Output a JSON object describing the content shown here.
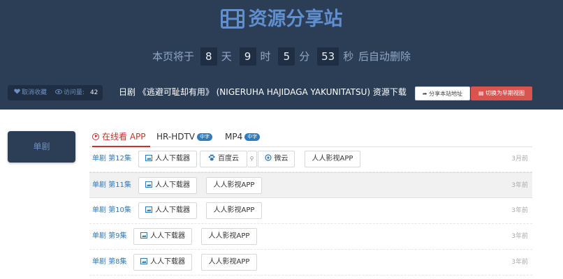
{
  "header": {
    "title": "资源分享站",
    "countdown": {
      "prefix": "本页将于",
      "days": "8",
      "days_unit": "天",
      "hours": "9",
      "hours_unit": "时",
      "minutes": "5",
      "minutes_unit": "分",
      "seconds": "53",
      "seconds_unit": "秒",
      "suffix": "后自动删除"
    },
    "stats": {
      "unfavorite": "取消收藏",
      "visits_label": "访问量:",
      "visits": "42"
    },
    "marquee": "日剧 《逃避可耻却有用》 (NIGERUHA HAJIDAGA YAKUNITATSU) 资源下载",
    "share_button": "分享本站地址",
    "switch_button": "切换为早期视图"
  },
  "sidebar": {
    "category_label": "单剧"
  },
  "tabs": [
    {
      "label": "在线看 APP",
      "badge": ""
    },
    {
      "label": "HR-HDTV",
      "badge": "中字"
    },
    {
      "label": "MP4",
      "badge": "中字"
    }
  ],
  "episodes": [
    {
      "label": "单剧 第12集",
      "time": "3月前",
      "buttons": [
        "人人下载器",
        "百度云",
        "微云",
        "人人影视APP"
      ]
    },
    {
      "label": "单剧 第11集",
      "time": "3年前",
      "buttons": [
        "人人下载器",
        "人人影视APP"
      ]
    },
    {
      "label": "单剧 第10集",
      "time": "3年前",
      "buttons": [
        "人人下载器",
        "人人影视APP"
      ]
    },
    {
      "label": "单剧 第9集",
      "time": "3年前",
      "buttons": [
        "人人下载器",
        "人人影视APP"
      ]
    },
    {
      "label": "单剧 第8集",
      "time": "3年前",
      "buttons": [
        "人人下载器",
        "人人影视APP"
      ]
    }
  ],
  "colors": {
    "header_bg": "#2c3e56",
    "accent": "#5f8fce",
    "danger": "#d9534f",
    "link": "#337ab7"
  }
}
